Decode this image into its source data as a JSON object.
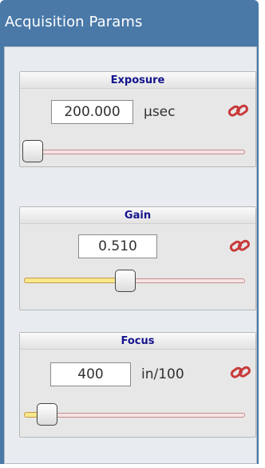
{
  "panel": {
    "title": "Acquisition Params"
  },
  "exposure": {
    "label": "Exposure",
    "value": "200.000",
    "unit": "μsec",
    "slider_fraction": 0.0
  },
  "gain": {
    "label": "Gain",
    "value": "0.510",
    "unit": "",
    "slider_fraction": 0.51
  },
  "focus": {
    "label": "Focus",
    "value": "400",
    "unit": "in/100",
    "slider_fraction": 0.13
  },
  "icons": {
    "lock": "link-chain-icon"
  },
  "colors": {
    "title_bar": "#4a79a8",
    "group_title": "#14148c",
    "slider_fill": "#f7e88a",
    "slider_track": "#c88c8c",
    "link_icon": "#c83a3a"
  }
}
